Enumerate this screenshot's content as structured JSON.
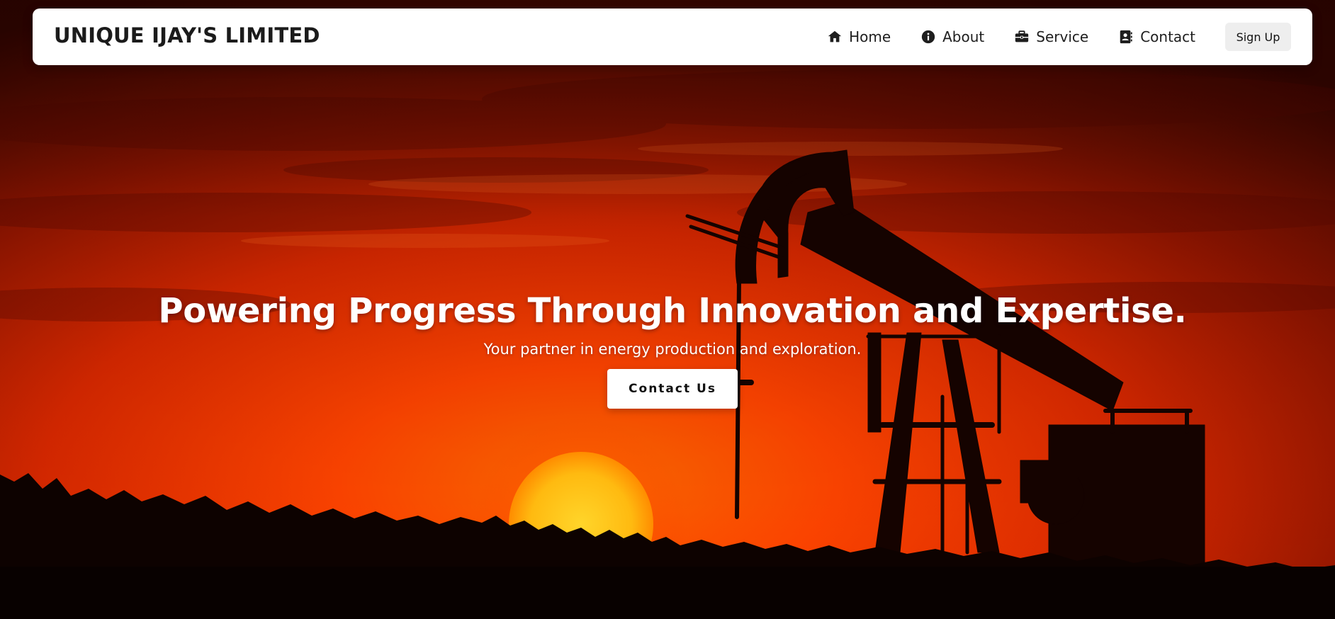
{
  "brand": {
    "name": "UNIQUE IJAY'S LIMITED"
  },
  "nav": {
    "items": [
      {
        "label": "Home",
        "icon": "home-icon"
      },
      {
        "label": "About",
        "icon": "info-icon"
      },
      {
        "label": "Service",
        "icon": "briefcase-icon"
      },
      {
        "label": "Contact",
        "icon": "address-book-icon"
      }
    ],
    "signup_label": "Sign Up"
  },
  "hero": {
    "title": "Powering Progress Through Innovation and Expertise.",
    "subtitle": "Your partner in energy production and exploration.",
    "cta_label": "Contact Us",
    "background": "sunset-oil-pumpjack-silhouette"
  },
  "colors": {
    "sky_dark": "#3a0600",
    "sky_mid": "#a51e00",
    "sky_bright": "#ff4a00",
    "sun_core": "#ffcc1a",
    "sun_edge": "#ff8a00",
    "silhouette": "#120300",
    "navbar_bg": "#ffffff",
    "button_bg": "#ffffff",
    "signup_bg": "#eeeeee"
  }
}
